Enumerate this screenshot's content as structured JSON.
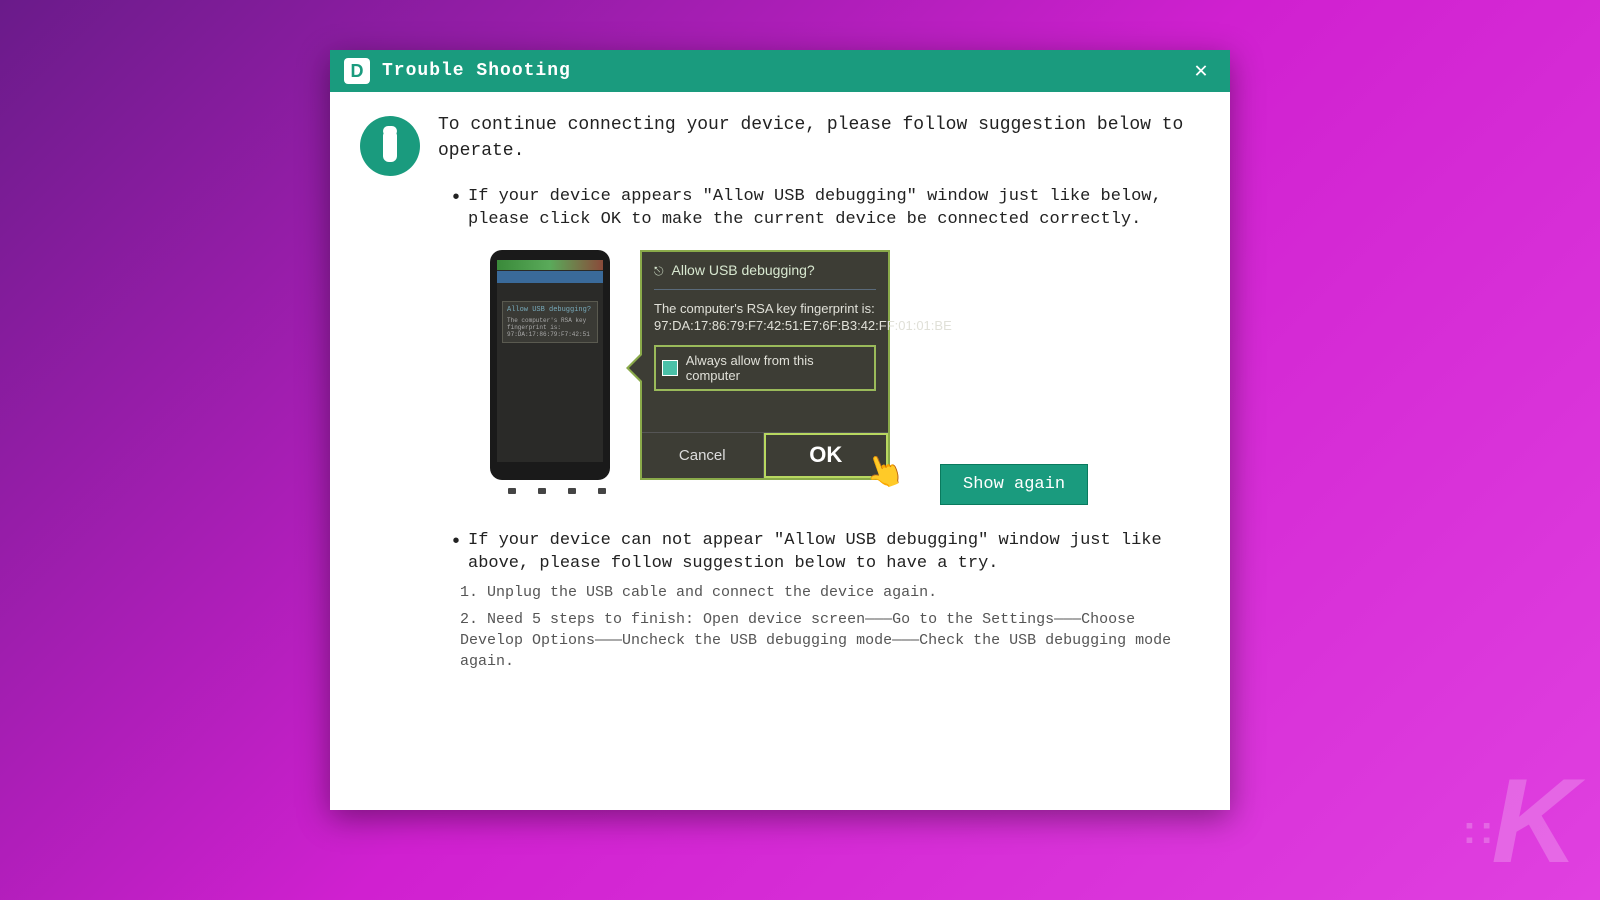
{
  "titlebar": {
    "app_icon_letter": "D",
    "title": "Trouble Shooting",
    "close": "✕"
  },
  "intro": "To continue connecting your device, please follow suggestion below to operate.",
  "bullets": {
    "b1": "If your device appears \"Allow USB debugging\" window just like below, please click OK to make the current device  be connected correctly.",
    "b2": "If your device can not appear \"Allow USB debugging\" window just like above, please follow suggestion below to have a try."
  },
  "popup": {
    "title": "Allow USB debugging?",
    "body_line1": "The computer's RSA key fingerprint is:",
    "body_line2": "97:DA:17:86:79:F7:42:51:E7:6F:B3:42:FF:01:01:BE",
    "always_allow": "Always allow from this computer",
    "cancel": "Cancel",
    "ok": "OK"
  },
  "show_again": "Show again",
  "steps": {
    "s1": "1. Unplug the USB cable and connect the device again.",
    "s2": "2. Need 5 steps to finish: Open device screen———Go to the Settings———Choose Develop Options———Uncheck the USB debugging mode———Check the USB debugging mode again."
  },
  "watermark": {
    "dots": "::",
    "letter": "K"
  }
}
